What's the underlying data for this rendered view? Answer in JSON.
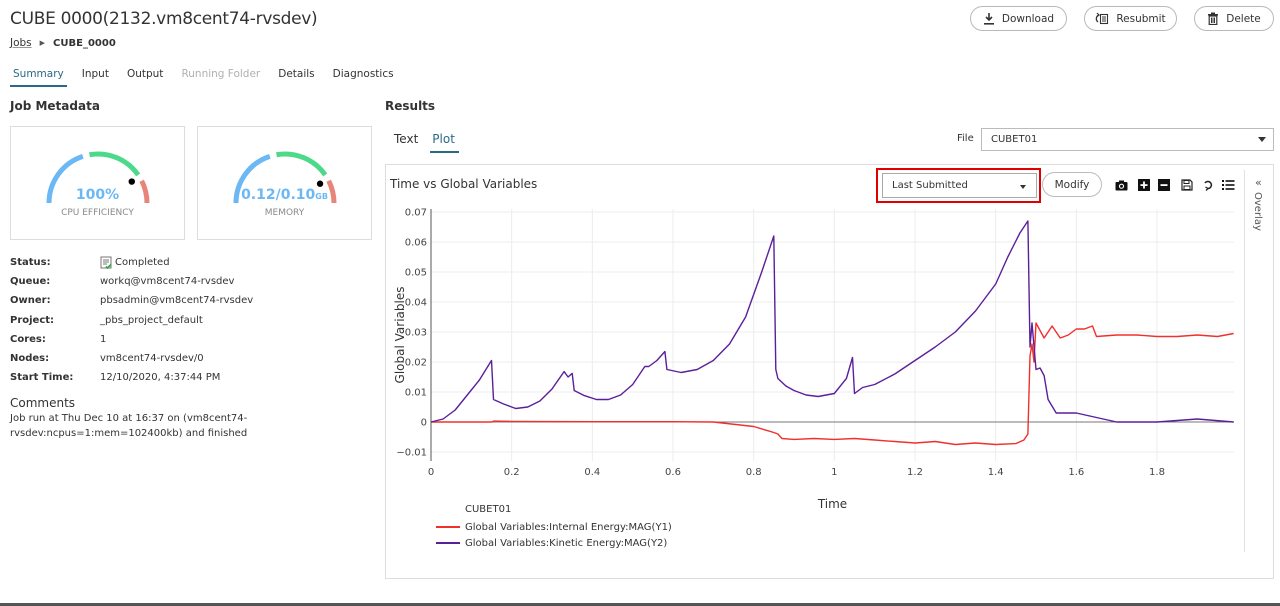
{
  "header": {
    "title": "CUBE  0000(2132.vm8cent74-rvsdev)",
    "breadcrumb": {
      "root": "Jobs",
      "current": "CUBE_0000"
    },
    "actions": {
      "download": "Download",
      "resubmit": "Resubmit",
      "delete": "Delete"
    }
  },
  "tabs": [
    {
      "label": "Summary",
      "state": "active"
    },
    {
      "label": "Input",
      "state": "normal"
    },
    {
      "label": "Output",
      "state": "normal"
    },
    {
      "label": "Running Folder",
      "state": "disabled"
    },
    {
      "label": "Details",
      "state": "normal"
    },
    {
      "label": "Diagnostics",
      "state": "normal"
    }
  ],
  "metadata": {
    "heading": "Job Metadata",
    "gauges": [
      {
        "value_text": "100%",
        "unit": "",
        "label": "CPU EFFICIENCY",
        "fraction": 0.82
      },
      {
        "value_text": "0.12/0.10",
        "unit": "GB",
        "label": "MEMORY",
        "fraction": 0.84
      }
    ],
    "fields": [
      {
        "key": "Status:",
        "value": "Completed",
        "icon": "completed-status-icon"
      },
      {
        "key": "Queue:",
        "value": "workq@vm8cent74-rvsdev"
      },
      {
        "key": "Owner:",
        "value": "pbsadmin@vm8cent74-rvsdev"
      },
      {
        "key": "Project:",
        "value": "_pbs_project_default"
      },
      {
        "key": "Cores:",
        "value": "1"
      },
      {
        "key": "Nodes:",
        "value": "vm8cent74-rvsdev/0"
      },
      {
        "key": "Start Time:",
        "value": "12/10/2020, 4:37:44 PM"
      }
    ],
    "comments_heading": "Comments",
    "comments": "Job run at Thu Dec 10 at 16:37 on (vm8cent74-rvsdev:ncpus=1:mem=102400kb) and finished"
  },
  "results": {
    "heading": "Results",
    "tabs": [
      {
        "label": "Text",
        "state": "normal"
      },
      {
        "label": "Plot",
        "state": "active"
      }
    ],
    "file_label": "File",
    "file_value": "CUBET01",
    "plot_selector": "Last Submitted",
    "modify_label": "Modify",
    "toolbar_icons": [
      "camera-icon",
      "zoom-in-icon",
      "zoom-out-icon",
      "save-icon",
      "reset-icon",
      "legend-list-icon"
    ],
    "overlay_label": "Overlay",
    "overlay_toggle": "«"
  },
  "colors": {
    "accent": "#2a6a86",
    "series_internal": "#f0302c",
    "series_kinetic": "#5b1f9a",
    "gauge_blue": "#6bb8f5",
    "gauge_green": "#4cd98a",
    "gauge_red": "#e8857a",
    "highlight": "#e00000"
  },
  "chart_data": {
    "type": "line",
    "title": "Time vs Global Variables",
    "xlabel": "Time",
    "ylabel": "Global Variables",
    "xlim": [
      0,
      1.99
    ],
    "ylim": [
      -0.013,
      0.071
    ],
    "xticks": [
      "0",
      "0.2",
      "0.4",
      "0.6",
      "0.8",
      "1",
      "1.2",
      "1.4",
      "1.6",
      "1.8"
    ],
    "yticks": [
      "−0.01",
      "0",
      "0.01",
      "0.02",
      "0.03",
      "0.04",
      "0.05",
      "0.06",
      "0.07"
    ],
    "grid": true,
    "legend_title": "CUBET01",
    "legend_position": "bottom-left",
    "series": [
      {
        "name": "Global Variables:Internal Energy:MAG(Y1)",
        "color": "#f0302c",
        "x": [
          0,
          0.15,
          0.155,
          0.2,
          0.4,
          0.6,
          0.7,
          0.8,
          0.85,
          0.86,
          0.87,
          0.9,
          0.95,
          1.0,
          1.05,
          1.1,
          1.15,
          1.2,
          1.25,
          1.3,
          1.35,
          1.4,
          1.45,
          1.47,
          1.48,
          1.485,
          1.49,
          1.495,
          1.5,
          1.52,
          1.54,
          1.56,
          1.58,
          1.6,
          1.62,
          1.64,
          1.65,
          1.7,
          1.75,
          1.8,
          1.85,
          1.9,
          1.95,
          1.99
        ],
        "y": [
          0,
          0,
          0.0003,
          0.0002,
          0.0001,
          0.0001,
          0,
          -0.0015,
          -0.0035,
          -0.004,
          -0.0055,
          -0.0058,
          -0.0055,
          -0.0058,
          -0.0055,
          -0.006,
          -0.0065,
          -0.007,
          -0.0065,
          -0.0075,
          -0.007,
          -0.0075,
          -0.0072,
          -0.006,
          -0.004,
          0.022,
          0.026,
          0.02,
          0.033,
          0.028,
          0.032,
          0.028,
          0.029,
          0.031,
          0.031,
          0.032,
          0.0285,
          0.029,
          0.029,
          0.0285,
          0.0285,
          0.029,
          0.0285,
          0.0295
        ]
      },
      {
        "name": "Global Variables:Kinetic Energy:MAG(Y2)",
        "color": "#5b1f9a",
        "x": [
          0,
          0.03,
          0.06,
          0.09,
          0.12,
          0.15,
          0.155,
          0.18,
          0.21,
          0.24,
          0.27,
          0.3,
          0.33,
          0.34,
          0.35,
          0.355,
          0.38,
          0.41,
          0.44,
          0.47,
          0.5,
          0.53,
          0.54,
          0.56,
          0.58,
          0.585,
          0.62,
          0.66,
          0.7,
          0.74,
          0.78,
          0.82,
          0.85,
          0.855,
          0.86,
          0.88,
          0.9,
          0.93,
          0.96,
          1.0,
          1.03,
          1.045,
          1.05,
          1.07,
          1.1,
          1.15,
          1.2,
          1.25,
          1.3,
          1.35,
          1.4,
          1.43,
          1.46,
          1.48,
          1.485,
          1.49,
          1.5,
          1.51,
          1.52,
          1.53,
          1.55,
          1.6,
          1.65,
          1.7,
          1.8,
          1.9,
          1.99
        ],
        "y": [
          0,
          0.001,
          0.004,
          0.009,
          0.014,
          0.0205,
          0.0075,
          0.006,
          0.0045,
          0.005,
          0.007,
          0.011,
          0.0168,
          0.015,
          0.0162,
          0.0105,
          0.0088,
          0.0075,
          0.0075,
          0.009,
          0.0125,
          0.0185,
          0.0185,
          0.0205,
          0.0235,
          0.0175,
          0.0165,
          0.0175,
          0.0205,
          0.026,
          0.035,
          0.05,
          0.062,
          0.0175,
          0.0145,
          0.012,
          0.0105,
          0.009,
          0.0085,
          0.0095,
          0.0145,
          0.0215,
          0.0095,
          0.0115,
          0.0125,
          0.016,
          0.0205,
          0.025,
          0.03,
          0.037,
          0.046,
          0.055,
          0.063,
          0.067,
          0.025,
          0.033,
          0.0175,
          0.018,
          0.0155,
          0.0075,
          0.003,
          0.003,
          0.0015,
          0,
          0,
          0.001,
          0
        ]
      }
    ]
  }
}
